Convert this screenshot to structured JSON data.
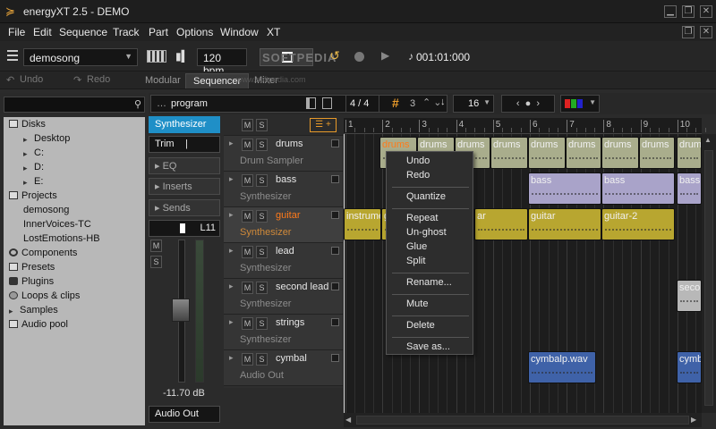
{
  "window": {
    "title": "energyXT 2.5 - DEMO",
    "min": "▁",
    "max": "❐",
    "close": "✕"
  },
  "menu": [
    "File",
    "Edit",
    "Sequence",
    "Track",
    "Part",
    "Options",
    "Window",
    "XT"
  ],
  "mdi": {
    "max": "❐",
    "close": "✕"
  },
  "toolbar": {
    "song": "demosong",
    "bpm": "120 bpm",
    "position": "001:01:000",
    "watermark": "SOFTPEDIA"
  },
  "toolbar2": {
    "undo": "Undo",
    "redo": "Redo",
    "tabs": [
      "Modular",
      "Sequencer",
      "Mixer"
    ],
    "watermark_url": "www.softpedia.com"
  },
  "browser": {
    "items": [
      {
        "label": "Disks",
        "level": 0,
        "icon": "disk"
      },
      {
        "label": "Desktop",
        "level": 1,
        "icon": "arrow"
      },
      {
        "label": "C:",
        "level": 1,
        "icon": "arrow"
      },
      {
        "label": "D:",
        "level": 1,
        "icon": "arrow"
      },
      {
        "label": "E:",
        "level": 1,
        "icon": "arrow"
      },
      {
        "label": "Projects",
        "level": 0,
        "icon": "folder"
      },
      {
        "label": "demosong",
        "level": 1,
        "icon": "none"
      },
      {
        "label": "InnerVoices-TC",
        "level": 1,
        "icon": "none"
      },
      {
        "label": "LostEmotions-HB",
        "level": 1,
        "icon": "none"
      },
      {
        "label": "Components",
        "level": 0,
        "icon": "gear"
      },
      {
        "label": "Presets",
        "level": 0,
        "icon": "folder"
      },
      {
        "label": "Plugins",
        "level": 0,
        "icon": "plug"
      },
      {
        "label": "Loops & clips",
        "level": 0,
        "icon": "loop"
      },
      {
        "label": "Samples",
        "level": 0,
        "icon": "arrow"
      },
      {
        "label": "Audio pool",
        "level": 0,
        "icon": "folder"
      }
    ]
  },
  "seqbar": {
    "program": "program",
    "page": "4 / 4",
    "grid": "3",
    "quant": "16"
  },
  "strip": {
    "instrument": "Synthesizer",
    "trim": "Trim",
    "eq": "EQ",
    "inserts": "Inserts",
    "sends": "Sends",
    "pan": "L11",
    "m": "M",
    "s": "S",
    "db": "-11.70 dB",
    "output": "Audio Out"
  },
  "tracks": [
    {
      "name": "drums",
      "sub": "Drum Sampler",
      "selected": false
    },
    {
      "name": "bass",
      "sub": "Synthesizer",
      "selected": false
    },
    {
      "name": "guitar",
      "sub": "Synthesizer",
      "selected": true
    },
    {
      "name": "lead",
      "sub": "Synthesizer",
      "selected": false
    },
    {
      "name": "second lead",
      "sub": "Synthesizer",
      "selected": false
    },
    {
      "name": "strings",
      "sub": "Synthesizer",
      "selected": false
    },
    {
      "name": "cymbal",
      "sub": "Audio Out",
      "selected": false
    }
  ],
  "ruler": [
    "1",
    "2",
    "3",
    "4",
    "5",
    "6",
    "7",
    "8",
    "9",
    "10"
  ],
  "parts": [
    {
      "label": "drums",
      "track": 0,
      "color": "#a9ad8c",
      "textColor": "#ff7a1a",
      "start": 40,
      "width": 42
    },
    {
      "label": "drums",
      "track": 0,
      "color": "#a9ad8c",
      "textColor": "#f0f0f0",
      "start": 82,
      "width": 42
    },
    {
      "label": "drums",
      "track": 0,
      "color": "#a9ad8c",
      "textColor": "#f0f0f0",
      "start": 124,
      "width": 40
    },
    {
      "label": "drums",
      "track": 0,
      "color": "#a9ad8c",
      "textColor": "#f0f0f0",
      "start": 164,
      "width": 42
    },
    {
      "label": "drums",
      "track": 0,
      "color": "#a9ad8c",
      "textColor": "#f0f0f0",
      "start": 206,
      "width": 42
    },
    {
      "label": "drums",
      "track": 0,
      "color": "#a9ad8c",
      "textColor": "#f0f0f0",
      "start": 248,
      "width": 40
    },
    {
      "label": "drums",
      "track": 0,
      "color": "#a9ad8c",
      "textColor": "#f0f0f0",
      "start": 288,
      "width": 42
    },
    {
      "label": "drums",
      "track": 0,
      "color": "#a9ad8c",
      "textColor": "#f0f0f0",
      "start": 330,
      "width": 40
    },
    {
      "label": "drums",
      "track": 0,
      "color": "#a9ad8c",
      "textColor": "#f0f0f0",
      "start": 372,
      "width": 28
    },
    {
      "label": "bass",
      "track": 1,
      "color": "#a9a3c9",
      "textColor": "#f0f0f0",
      "start": 206,
      "width": 82
    },
    {
      "label": "bass",
      "track": 1,
      "color": "#a9a3c9",
      "textColor": "#f0f0f0",
      "start": 288,
      "width": 82
    },
    {
      "label": "bass",
      "track": 1,
      "color": "#a9a3c9",
      "textColor": "#f0f0f0",
      "start": 372,
      "width": 28
    },
    {
      "label": "instrume",
      "track": 2,
      "color": "#b8a630",
      "textColor": "#f0f0f0",
      "start": 0,
      "width": 42
    },
    {
      "label": "g",
      "track": 2,
      "color": "#b8a630",
      "textColor": "#f0f0f0",
      "start": 42,
      "width": 104
    },
    {
      "label": "ar",
      "track": 2,
      "color": "#b8a630",
      "textColor": "#f0f0f0",
      "start": 146,
      "width": 60
    },
    {
      "label": "guitar",
      "track": 2,
      "color": "#b8a630",
      "textColor": "#f0f0f0",
      "start": 206,
      "width": 82
    },
    {
      "label": "guitar-2",
      "track": 2,
      "color": "#b8a630",
      "textColor": "#f0f0f0",
      "start": 288,
      "width": 82
    },
    {
      "label": "seco",
      "track": 4,
      "color": "#b8b8b8",
      "textColor": "#f0f0f0",
      "start": 372,
      "width": 28
    },
    {
      "label": "cymbalp.wav",
      "track": 6,
      "color": "#3f62a8",
      "textColor": "#f0f0f0",
      "start": 206,
      "width": 76
    },
    {
      "label": "cymb",
      "track": 6,
      "color": "#3f62a8",
      "textColor": "#f0f0f0",
      "start": 372,
      "width": 28
    }
  ],
  "context_menu": {
    "groups": [
      [
        "Undo",
        "Redo"
      ],
      [
        "Quantize"
      ],
      [
        "Repeat",
        "Un-ghost",
        "Glue",
        "Split"
      ],
      [
        "Rename..."
      ],
      [
        "Mute"
      ],
      [
        "Delete"
      ],
      [
        "Save as..."
      ]
    ]
  },
  "colors": {
    "accent": "#ff7a1a",
    "instrument_bg": "#1f8fc7",
    "tree_bg": "#b8b8b8"
  }
}
